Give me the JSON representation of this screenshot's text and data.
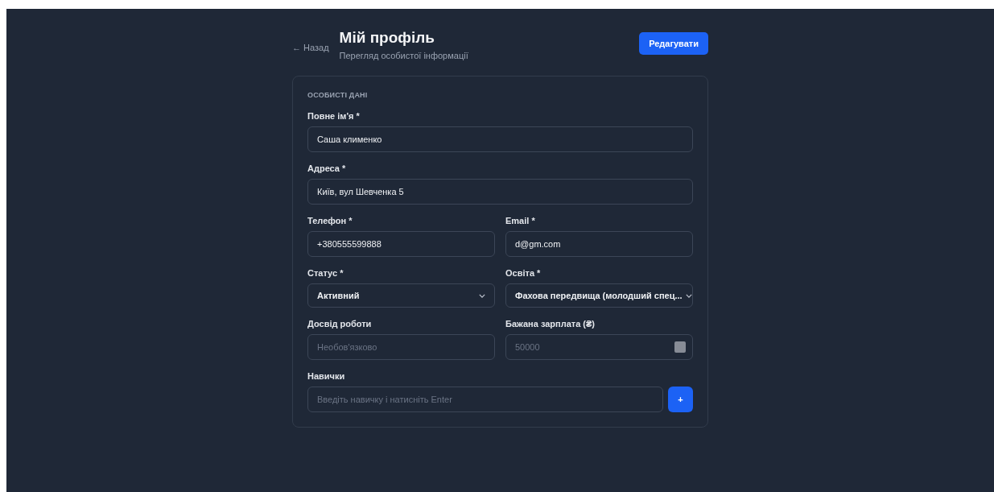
{
  "header": {
    "back_link": "← Назад",
    "title": "Мій профіль",
    "subtitle": "Перегляд особистої інформації",
    "edit_button": "Редагувати"
  },
  "card": {
    "section_title": "ОСОБИСТІ ДАНІ",
    "rows": [
      [
        {
          "kind": "text",
          "label": "Повне ім'я *",
          "value": "Саша клименко"
        }
      ],
      [
        {
          "kind": "text",
          "label": "Адреса *",
          "value": "Київ, вул Шевченка 5"
        }
      ],
      [
        {
          "kind": "text",
          "label": "Телефон *",
          "value": "+380555599888"
        },
        {
          "kind": "text",
          "label": "Email *",
          "value": "d@gm.com"
        }
      ],
      [
        {
          "kind": "select",
          "label": "Статус *",
          "value": "Активний"
        },
        {
          "kind": "select",
          "label": "Освіта *",
          "value": "Фахова передвища (молодший спец..."
        }
      ],
      [
        {
          "kind": "text",
          "label": "Досвід роботи",
          "placeholder": "Необов'язково"
        },
        {
          "kind": "number",
          "label": "Бажана зарплата (₴)",
          "placeholder": "50000"
        }
      ]
    ],
    "skills": {
      "label": "Навички",
      "placeholder": "Введіть навичку і натисніть Enter",
      "add_button": "+"
    }
  }
}
